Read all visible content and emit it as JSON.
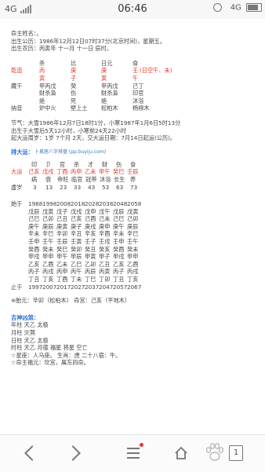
{
  "status_bar": {
    "network": "4G",
    "time": "06:46",
    "right_net": "4G"
  },
  "chart": {
    "name_line": "命主姓名：。",
    "solar_line": "出生公历：1986年12月12日07时37分(北京时间)，星期五。",
    "lunar_line": "出生农历：丙寅年 十一月 十一日 辰时。",
    "pillar_headers": [
      "杀",
      "比",
      "日元",
      "食"
    ],
    "qiangzao_label": "乾造",
    "stems": [
      "丙",
      "庚",
      "庚",
      "壬"
    ],
    "kongwang": "(日空午、未)",
    "branches": [
      "寅",
      "子",
      "寅",
      "午"
    ],
    "canggan_label": "藏干",
    "canggan_row1": [
      "甲丙戊",
      "癸",
      "甲丙戊",
      "己丁"
    ],
    "canggan_row2": [
      "财杀枭",
      "伤",
      "财杀枭",
      "印官"
    ],
    "lu_row_label": "",
    "lu_row": [
      "绝",
      "死",
      "绝",
      "沐浴"
    ],
    "nayin_label": "纳音",
    "nayin_row": [
      "炉中火",
      "壁上土",
      "松柏木",
      "杨柳木"
    ],
    "jieqi_line1": "节气：大雪1986年12月7日18时1分，小寒1987年1月6日5时13分",
    "jieqi_line2": "出生于大雪后5天12小时，小寒前24天22小时",
    "dayun_line": "起大运周岁：1岁 7个月 2天，交大运日期：7月14日起运(公历)。",
    "paidayun_title": "排大运：",
    "paidayun_note": "卜易居八字排盘 (pp.buyiju.com)",
    "dayun_gods": [
      "印",
      "卩",
      "官",
      "杀",
      "才",
      "财",
      "伤",
      "食"
    ],
    "dayun_label": "大运",
    "dayun_pillars": [
      "己亥",
      "戊戌",
      "丁酉",
      "丙申",
      "乙未",
      "甲午",
      "癸巳",
      "壬辰"
    ],
    "dayun_states": [
      "病",
      "衰",
      "帝旺",
      "临官",
      "冠带",
      "沐浴",
      "长生",
      "养"
    ],
    "xusui_label": "虚岁",
    "xusui_values": [
      "3",
      "13",
      "23",
      "33",
      "43",
      "53",
      "63",
      "73"
    ],
    "start_label": "始于",
    "start_years": [
      "1988",
      "1998",
      "2008",
      "2018",
      "2028",
      "2038",
      "2048",
      "2058"
    ],
    "liunian_rows": [
      [
        "戊辰",
        "戊寅",
        "戊子",
        "戊戌",
        "戊申",
        "戊午",
        "戊辰",
        "戊寅"
      ],
      [
        "己巳",
        "己卯",
        "己丑",
        "己亥",
        "己酉",
        "己未",
        "己巳",
        "己卯"
      ],
      [
        "庚午",
        "庚辰",
        "庚寅",
        "庚子",
        "庚戌",
        "庚申",
        "庚午",
        "庚辰"
      ],
      [
        "辛未",
        "辛巳",
        "辛卯",
        "辛丑",
        "辛亥",
        "辛酉",
        "辛未",
        "辛巳"
      ],
      [
        "壬申",
        "壬午",
        "壬辰",
        "壬寅",
        "壬子",
        "壬戌",
        "壬申",
        "壬午"
      ],
      [
        "癸酉",
        "癸未",
        "癸巳",
        "癸卯",
        "癸丑",
        "癸亥",
        "癸酉",
        "癸未"
      ],
      [
        "甲戌",
        "甲申",
        "甲午",
        "甲辰",
        "甲寅",
        "甲子",
        "甲戌",
        "甲申"
      ],
      [
        "乙亥",
        "乙酉",
        "乙未",
        "乙巳",
        "乙卯",
        "乙丑",
        "乙亥",
        "乙酉"
      ],
      [
        "丙子",
        "丙戌",
        "丙申",
        "丙午",
        "丙辰",
        "丙寅",
        "丙子",
        "丙戌"
      ],
      [
        "丁丑",
        "丁亥",
        "丁酉",
        "丁未",
        "丁巳",
        "丁卯",
        "丁丑",
        "丁亥"
      ]
    ],
    "end_label": "止于",
    "end_years": [
      "1997",
      "2007",
      "2017",
      "2027",
      "2037",
      "2047",
      "2057",
      "2067"
    ],
    "taiyuan_line": "※胎元：辛卯（松柏木）    命宫：己亥（平地木）",
    "shensha_title": "吉神凶煞：",
    "shensha_lines": [
      "年柱 天乙 太极",
      "月柱 灾煞",
      "日柱 天乙 太极",
      "时柱 天乙 月德 福星 将星 空亡",
      "☆星座：人马座。  生肖：虎  二十八宿：牛。",
      "☆命主福元：坎宫，属东四命。"
    ]
  },
  "navbar": {
    "tab_count": "1"
  },
  "colors": {
    "accent_red": "#e23b2a",
    "accent_blue": "#2a6fd0"
  },
  "icons": [
    "back-chevron-icon",
    "forward-chevron-icon",
    "menu-icon",
    "home-icon",
    "paw-icon",
    "tabs-icon"
  ]
}
